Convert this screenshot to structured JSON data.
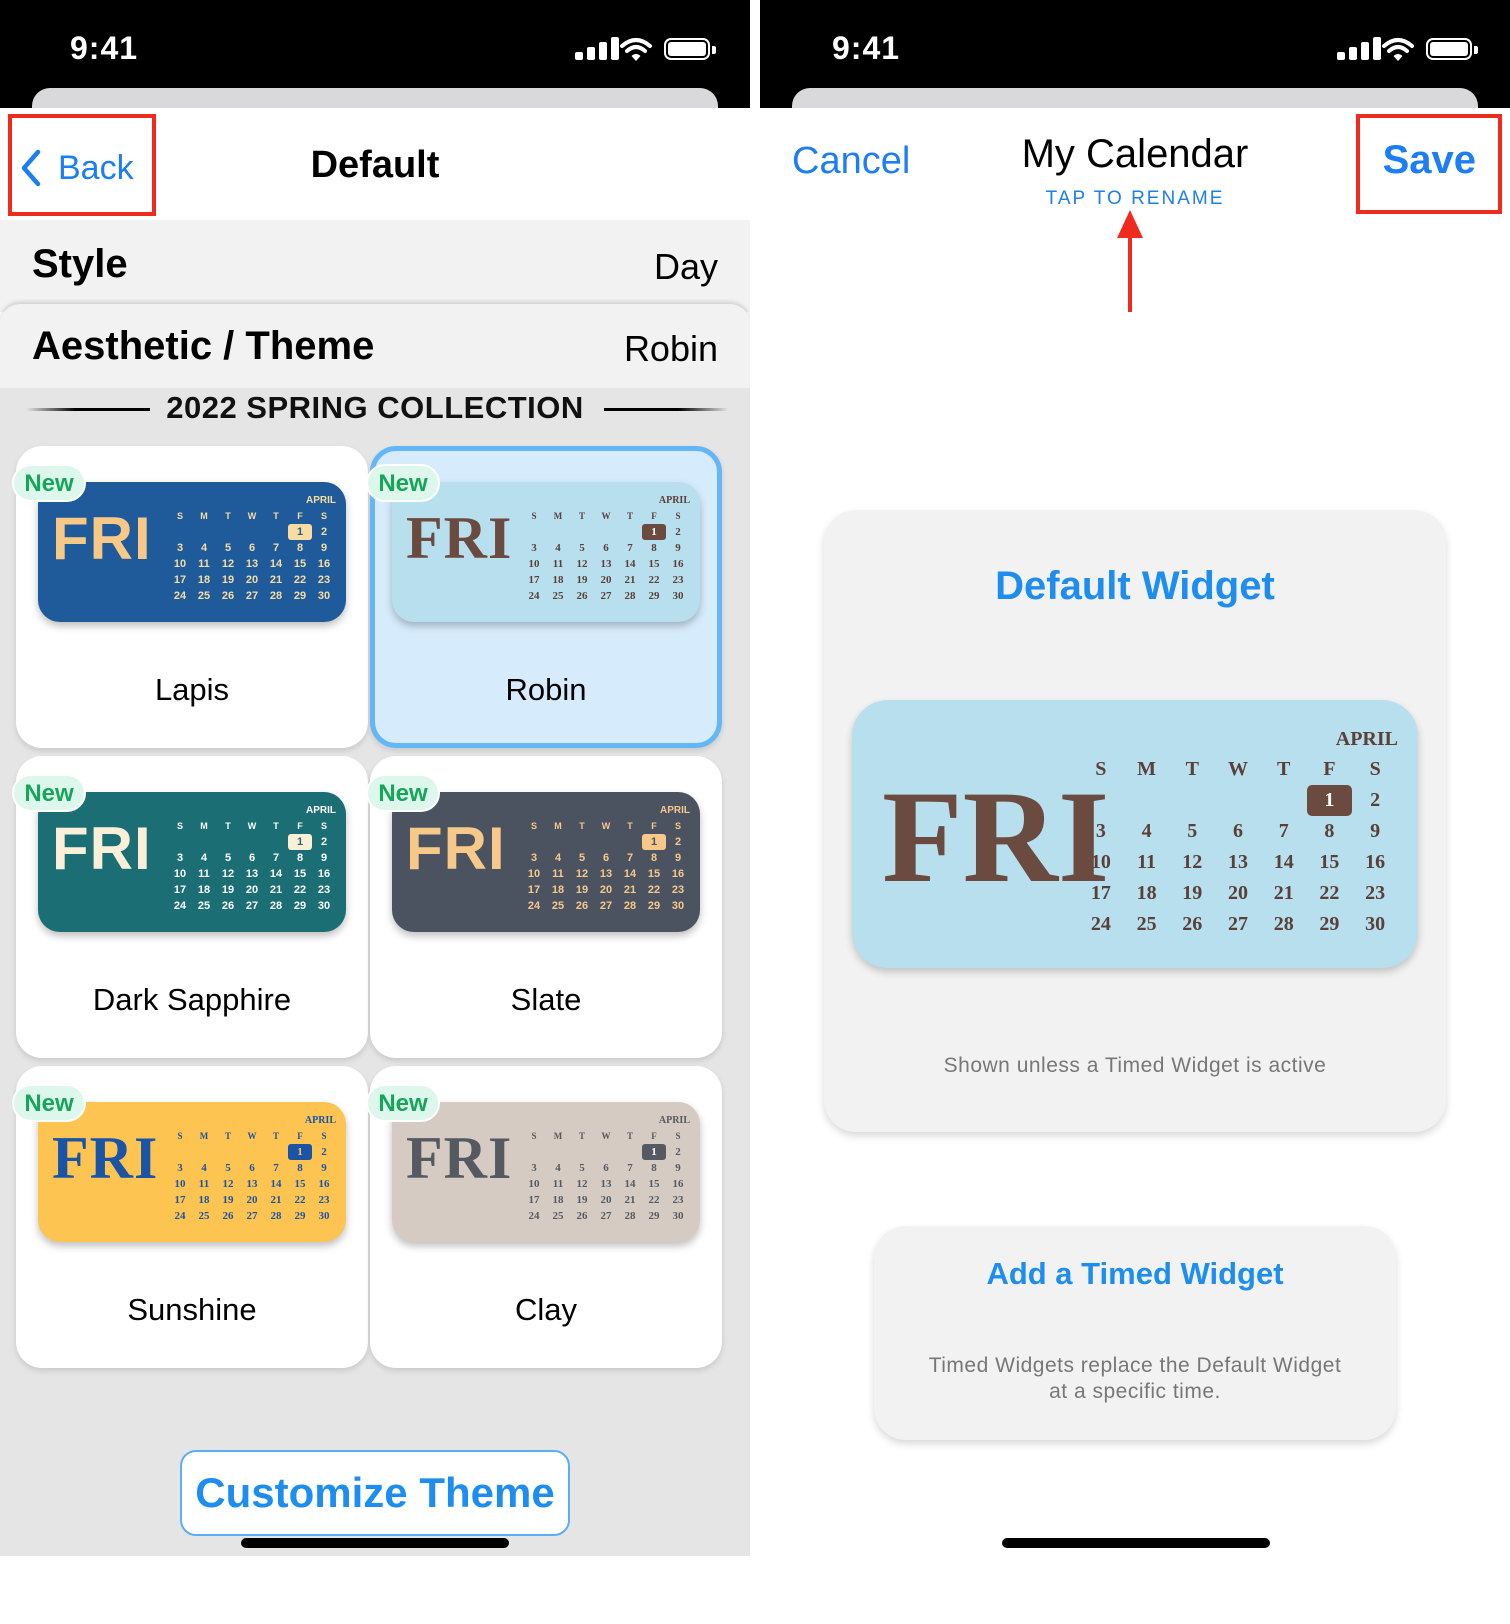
{
  "left": {
    "status": {
      "time": "9:41"
    },
    "nav": {
      "back_label": "Back",
      "title": "Default"
    },
    "style_row": {
      "label": "Style",
      "value": "Day"
    },
    "theme_row": {
      "label": "Aesthetic / Theme",
      "value": "Robin"
    },
    "collection_title": "2022 SPRING COLLECTION",
    "themes": [
      {
        "name": "Lapis",
        "badge": "New",
        "selected": false,
        "bg": "#1f5b9a",
        "fri": "#f8c986",
        "text": "#f8dca0",
        "today_bg": "#f8dca0",
        "today_fg": "#1f5b9a",
        "serif": false
      },
      {
        "name": "Robin",
        "badge": "New",
        "selected": true,
        "bg": "#b8dfee",
        "fri": "#6b4a3f",
        "text": "#5a4038",
        "today_bg": "#6b4a3f",
        "today_fg": "#ffffff",
        "serif": true
      },
      {
        "name": "Dark Sapphire",
        "badge": "New",
        "selected": false,
        "bg": "#1b6e74",
        "fri": "#fbefd8",
        "text": "#ffffff",
        "today_bg": "#fbefd8",
        "today_fg": "#1b6e74",
        "serif": false
      },
      {
        "name": "Slate",
        "badge": "New",
        "selected": false,
        "bg": "#4b5260",
        "fri": "#f6c98a",
        "text": "#f6c98a",
        "today_bg": "#f6c98a",
        "today_fg": "#4b5260",
        "serif": false
      },
      {
        "name": "Sunshine",
        "badge": "New",
        "selected": false,
        "bg": "#fdc452",
        "fri": "#1a54a6",
        "text": "#1a54a6",
        "today_bg": "#1a54a6",
        "today_fg": "#fdc452",
        "serif": true
      },
      {
        "name": "Clay",
        "badge": "New",
        "selected": false,
        "bg": "#d6cbc2",
        "fri": "#555a62",
        "text": "#555a62",
        "today_bg": "#555a62",
        "today_fg": "#ffffff",
        "serif": true
      }
    ],
    "calendar": {
      "day": "FRI",
      "month": "APRIL",
      "headers": [
        "S",
        "M",
        "T",
        "W",
        "T",
        "F",
        "S"
      ],
      "rows": [
        [
          "",
          "",
          "",
          "",
          "",
          "1",
          "2"
        ],
        [
          "3",
          "4",
          "5",
          "6",
          "7",
          "8",
          "9"
        ],
        [
          "10",
          "11",
          "12",
          "13",
          "14",
          "15",
          "16"
        ],
        [
          "17",
          "18",
          "19",
          "20",
          "21",
          "22",
          "23"
        ],
        [
          "24",
          "25",
          "26",
          "27",
          "28",
          "29",
          "30"
        ]
      ],
      "today": "1"
    },
    "customize_label": "Customize Theme"
  },
  "right": {
    "status": {
      "time": "9:41"
    },
    "nav": {
      "cancel_label": "Cancel",
      "title": "My Calendar",
      "rename_hint": "TAP TO RENAME",
      "save_label": "Save"
    },
    "default_widget": {
      "title": "Default Widget",
      "subtitle": "Shown unless a Timed Widget is active"
    },
    "timed_widget": {
      "title": "Add a Timed Widget",
      "subtitle_line1": "Timed Widgets replace the Default Widget",
      "subtitle_line2": "at a specific time."
    }
  },
  "colors": {
    "accent": "#1d7df2",
    "highlight": "#ef2b1d",
    "selected_border": "#64b7f6"
  }
}
